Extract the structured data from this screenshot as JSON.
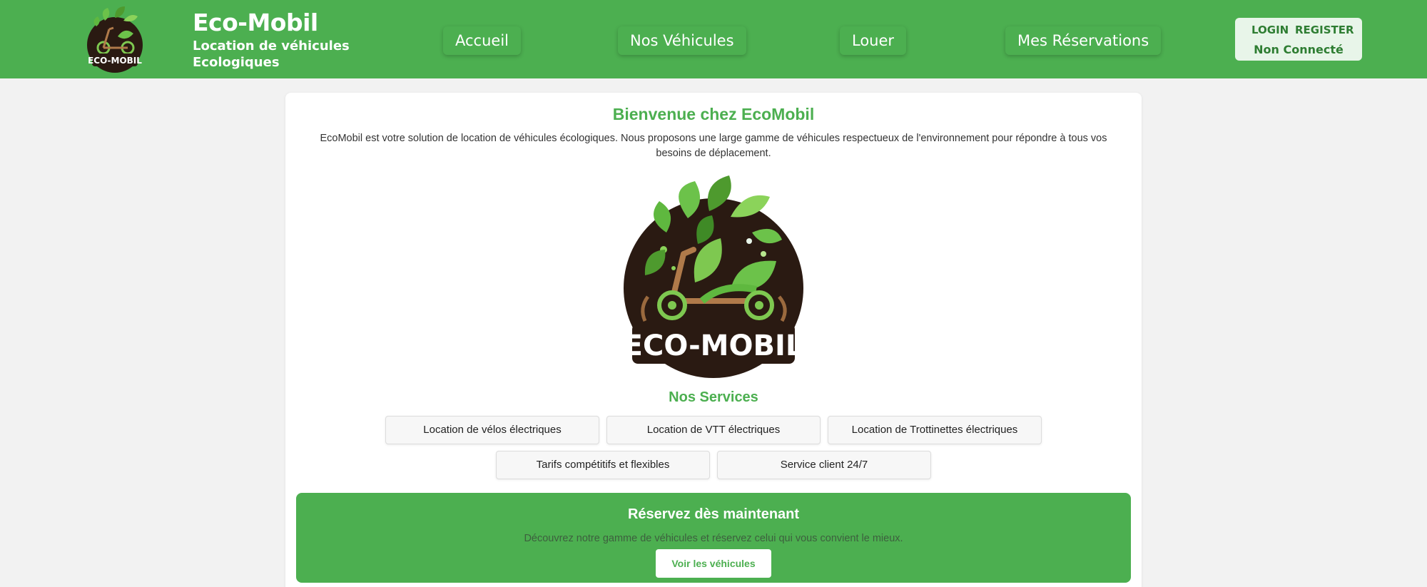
{
  "header": {
    "brand_title": "Eco-Mobil",
    "brand_subtitle": "Location de véhicules Ecologiques",
    "logo_text": "ECO-MOBIL",
    "nav": [
      {
        "label": "Accueil"
      },
      {
        "label": "Nos Véhicules"
      },
      {
        "label": "Louer"
      },
      {
        "label": "Mes Réservations"
      }
    ],
    "auth": {
      "login_label": "LOGIN",
      "register_label": "REGISTER",
      "status": "Non Connecté"
    }
  },
  "main": {
    "welcome_title": "Bienvenue chez EcoMobil",
    "welcome_text": "EcoMobil est votre solution de location de véhicules écologiques. Nous proposons une large gamme de véhicules respectueux de l'environnement pour répondre à tous vos besoins de déplacement.",
    "logo_text": "ECO-MOBIL",
    "services_title": "Nos Services",
    "services": [
      "Location de vélos électriques",
      "Location de VTT électriques",
      "Location de Trottinettes électriques",
      "Tarifs compétitifs et flexibles",
      "Service client 24/7"
    ],
    "cta": {
      "title": "Réservez dès maintenant",
      "text": "Découvrez notre gamme de véhicules et réservez celui qui vous convient le mieux.",
      "button_label": "Voir les véhicules"
    }
  },
  "colors": {
    "primary": "#4caf50",
    "logo_dark": "#2a1a12",
    "auth_bg": "#e8f5e9"
  }
}
